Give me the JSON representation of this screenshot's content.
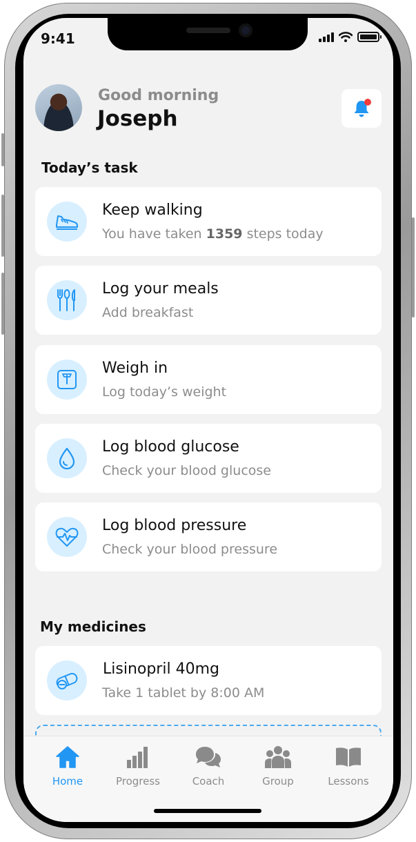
{
  "status_bar": {
    "time": "9:41"
  },
  "header": {
    "greeting": "Good morning",
    "user_name": "Joseph"
  },
  "sections": {
    "tasks_title": "Today’s task",
    "medicines_title": "My medicines"
  },
  "tasks": [
    {
      "title": "Keep walking",
      "sub_prefix": "You have taken ",
      "sub_value": "1359",
      "sub_suffix": " steps today",
      "icon": "sneaker-icon"
    },
    {
      "title": "Log your meals",
      "subtitle": "Add breakfast",
      "icon": "cutlery-icon"
    },
    {
      "title": "Weigh in",
      "subtitle": "Log today’s weight",
      "icon": "scale-icon"
    },
    {
      "title": "Log blood glucose",
      "subtitle": "Check your blood glucose",
      "icon": "droplet-icon"
    },
    {
      "title": "Log blood pressure",
      "subtitle": "Check your blood pressure",
      "icon": "heart-pulse-icon"
    }
  ],
  "medicines": [
    {
      "title": "Lisinopril 40mg",
      "subtitle": "Take 1 tablet by 8:00 AM",
      "icon": "pill-icon"
    }
  ],
  "tabbar": {
    "items": [
      {
        "label": "Home",
        "icon": "home-icon",
        "active": true
      },
      {
        "label": "Progress",
        "icon": "bar-chart-icon",
        "active": false
      },
      {
        "label": "Coach",
        "icon": "chat-bubbles-icon",
        "active": false
      },
      {
        "label": "Group",
        "icon": "people-icon",
        "active": false
      },
      {
        "label": "Lessons",
        "icon": "book-icon",
        "active": false
      }
    ]
  },
  "colors": {
    "accent": "#2196f3",
    "icon_bg": "#d8efff",
    "screen_bg": "#f2f2f2",
    "notification_dot": "#f23c3c"
  }
}
